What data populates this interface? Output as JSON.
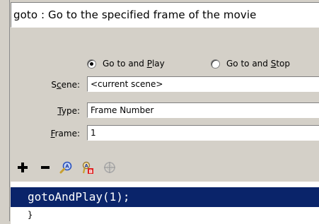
{
  "description": "goto : Go to the specified frame of the movie",
  "radios": [
    {
      "prefix": "Go to and ",
      "mnemonic": "P",
      "suffix": "lay",
      "checked": true
    },
    {
      "prefix": "Go to and ",
      "mnemonic": "S",
      "suffix": "top",
      "checked": false
    }
  ],
  "fields": {
    "scene": {
      "label_pre": "S",
      "label_mn": "c",
      "label_post": "ene:",
      "value": "<current scene>"
    },
    "type": {
      "label_pre": "",
      "label_mn": "T",
      "label_post": "ype:",
      "value": "Frame Number"
    },
    "frame": {
      "label_pre": "",
      "label_mn": "F",
      "label_post": "rame:",
      "value": "1"
    }
  },
  "toolbar": {
    "icons": [
      "plus-icon",
      "minus-icon",
      "find-icon",
      "replace-icon",
      "target-icon"
    ]
  },
  "code": {
    "selected_line": "gotoAndPlay(1);",
    "next_line": "}"
  }
}
